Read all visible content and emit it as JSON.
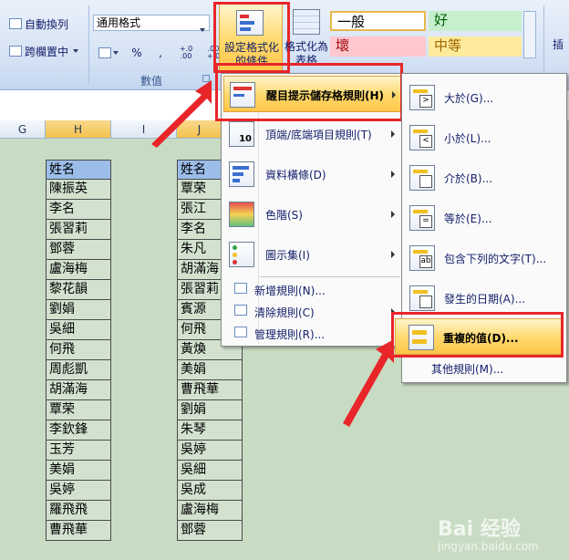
{
  "ribbon": {
    "wrap_text": "自動換列",
    "merge_center": "跨欄置中",
    "number_format": "通用格式",
    "percent": "%",
    "comma": ",",
    "dec_inc": "+.0 .00",
    "dec_dec": ".00 +.0",
    "number_group": "數值",
    "cond_format": "設定格式化的條件",
    "format_table": "格式化為表格",
    "styles": {
      "normal": "一般",
      "good": "好",
      "bad": "壞",
      "neutral": "中等"
    },
    "insert": "插"
  },
  "columns": {
    "G": "G",
    "H": "H",
    "I": "I",
    "J": "J"
  },
  "list_h": [
    "姓名",
    "陳振英",
    "李名",
    "張習莉",
    "鄧蓉",
    "盧海梅",
    "黎花韻",
    "劉娟",
    "吳細",
    "何飛",
    "周彪凱",
    "胡滿海",
    "覃荣",
    "李欽鋒",
    "玉芳",
    "美娟",
    "吳婷",
    "羅飛飛",
    "曹飛華"
  ],
  "list_j": [
    "姓名",
    "覃荣",
    "張江",
    "李名",
    "朱凡",
    "胡滿海",
    "張習莉",
    "賓源",
    "何飛",
    "黃煥",
    "美娟",
    "曹飛華",
    "劉娟",
    "朱琴",
    "吳婷",
    "吳細",
    "吳成",
    "盧海梅",
    "鄧蓉"
  ],
  "menu_main": {
    "highlight_rules": "醒目提示儲存格規則(H)",
    "top_bottom": "頂端/底端項目規則(T)",
    "data_bars": "資料橫條(D)",
    "color_scales": "色階(S)",
    "icon_sets": "圖示集(I)",
    "new_rule": "新增規則(N)...",
    "clear_rules": "清除規則(C)",
    "manage_rules": "管理規則(R)..."
  },
  "menu_sub": {
    "greater": "大於(G)...",
    "less": "小於(L)...",
    "between": "介於(B)...",
    "equal": "等於(E)...",
    "text_contains": "包含下列的文字(T)...",
    "date_occurring": "發生的日期(A)...",
    "duplicate": "重複的值(D)...",
    "more_rules": "其他規則(M)..."
  },
  "watermark": {
    "brand": "Bai 经验",
    "url": "jingyan.baidu.com"
  },
  "colors": {
    "accent_red": "#e8262a",
    "highlight": "#ffd86a",
    "header_blue": "#9bbde8",
    "sheet_green": "#c8dcc3"
  }
}
